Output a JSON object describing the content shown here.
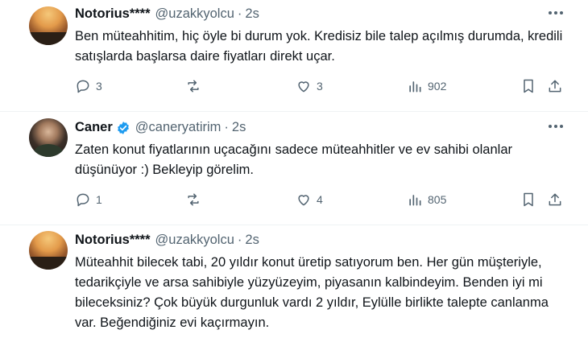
{
  "tweets": [
    {
      "author": "Notorius****",
      "handle": "@uzakkyolcu",
      "time": "2s",
      "text": "Ben müteahhitim, hiç öyle bi durum yok. Kredisiz bile talep açılmış durumda, kredili satışlarda başlarsa daire fiyatları direkt uçar.",
      "replies": "3",
      "retweets": "",
      "likes": "3",
      "views": "902"
    },
    {
      "author": "Caner",
      "handle": "@caneryatirim",
      "time": "2s",
      "verified": true,
      "text": "Zaten konut fiyatlarının uçacağını sadece müteahhitler ve ev sahibi olanlar düşünüyor :) Bekleyip görelim.",
      "replies": "1",
      "retweets": "",
      "likes": "4",
      "views": "805"
    },
    {
      "author": "Notorius****",
      "handle": "@uzakkyolcu",
      "time": "2s",
      "text": "Müteahhit bilecek tabi, 20 yıldır konut üretip satıyorum ben. Her gün müşteriyle, tedarikçiyle ve arsa sahibiyle yüzyüzeyim, piyasanın kalbindeyim. Benden iyi mi bileceksiniz? Çok büyük durgunluk vardı 2 yıldır, Eylülle birlikte talepte canlanma var. Beğendiğiniz evi kaçırmayın."
    }
  ],
  "icons": {
    "reply": "reply-icon",
    "retweet": "retweet-icon",
    "like": "heart-icon",
    "views": "views-icon",
    "bookmark": "bookmark-icon",
    "share": "share-icon",
    "more": "more-icon",
    "verified": "verified-badge-icon"
  },
  "colors": {
    "text": "#0f1419",
    "muted": "#536471",
    "verified": "#1d9bf0"
  }
}
